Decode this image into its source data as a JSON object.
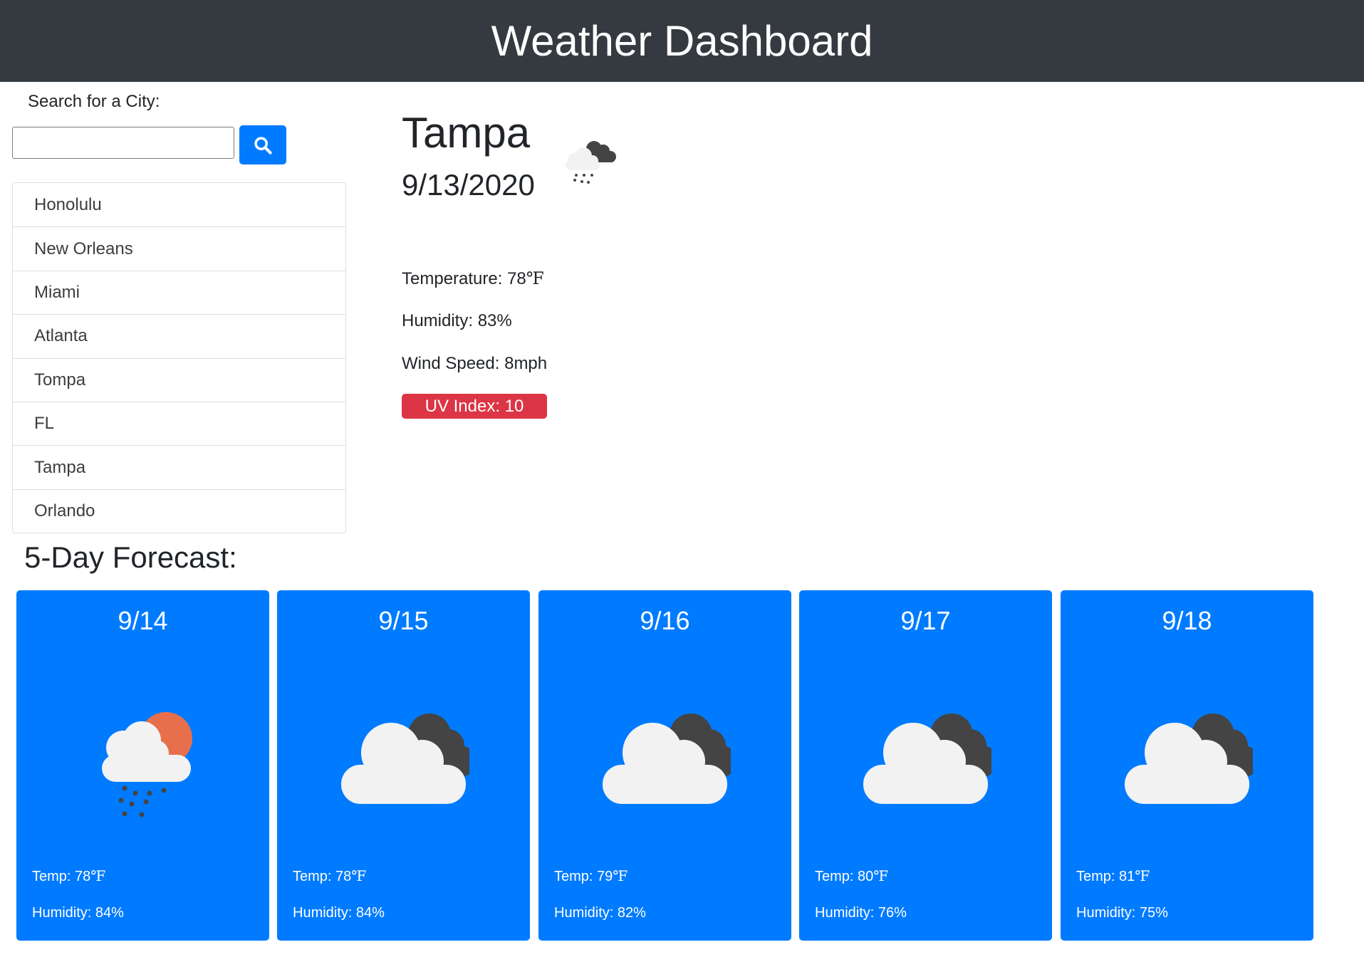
{
  "header": {
    "title": "Weather Dashboard"
  },
  "search": {
    "label": "Search for a City:",
    "value": "",
    "placeholder": "",
    "button_icon": "search-icon"
  },
  "history": [
    "Honolulu",
    "New Orleans",
    "Miami",
    "Atlanta",
    "Tompa",
    "FL",
    "Tampa",
    "Orlando"
  ],
  "current": {
    "city": "Tampa",
    "date": "9/13/2020",
    "icon": "cloud-rain-icon",
    "temperature_label": "Temperature:",
    "temperature_value": "78",
    "unit": "℉",
    "humidity_label": "Humidity:",
    "humidity_value": "83%",
    "wind_label": "Wind Speed:",
    "wind_value": "8mph",
    "uv_label": "UV Index:",
    "uv_value": "10",
    "uv_color": "#dc3545"
  },
  "forecast": {
    "title": "5-Day Forecast:",
    "temp_label": "Temp:",
    "humidity_label": "Humidity:",
    "unit": "℉",
    "card_color": "#007bff",
    "days": [
      {
        "date": "9/14",
        "icon": "sun-cloud-rain-icon",
        "temp": "78",
        "humidity": "84%"
      },
      {
        "date": "9/15",
        "icon": "broken-clouds-icon",
        "temp": "78",
        "humidity": "84%"
      },
      {
        "date": "9/16",
        "icon": "broken-clouds-icon",
        "temp": "79",
        "humidity": "82%"
      },
      {
        "date": "9/17",
        "icon": "broken-clouds-icon",
        "temp": "80",
        "humidity": "76%"
      },
      {
        "date": "9/18",
        "icon": "broken-clouds-icon",
        "temp": "81",
        "humidity": "75%"
      }
    ]
  }
}
